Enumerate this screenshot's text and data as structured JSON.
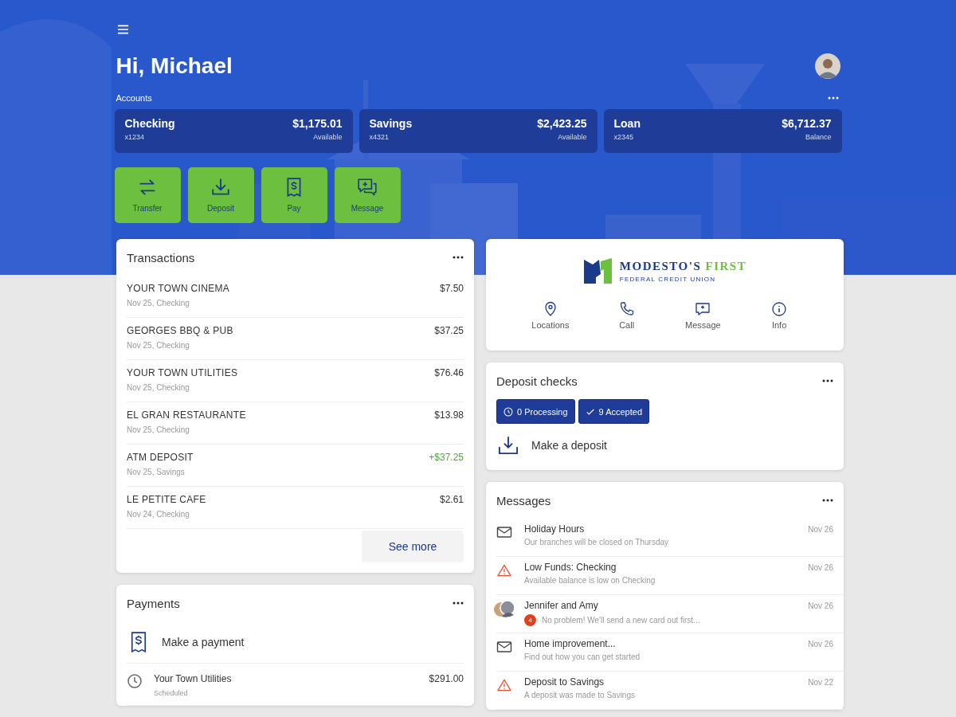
{
  "greeting": "Hi, Michael",
  "accounts_label": "Accounts",
  "accounts": [
    {
      "name": "Checking",
      "number": "x1234",
      "amount": "$1,175.01",
      "caption": "Available"
    },
    {
      "name": "Savings",
      "number": "x4321",
      "amount": "$2,423.25",
      "caption": "Available"
    },
    {
      "name": "Loan",
      "number": "x2345",
      "amount": "$6,712.37",
      "caption": "Balance"
    }
  ],
  "actions": [
    {
      "label": "Transfer",
      "kind": "transfer"
    },
    {
      "label": "Deposit",
      "kind": "deposit"
    },
    {
      "label": "Pay",
      "kind": "pay"
    },
    {
      "label": "Message",
      "kind": "message"
    }
  ],
  "transactions": {
    "title": "Transactions",
    "see_more": "See more",
    "rows": [
      {
        "merchant": "YOUR TOWN CINEMA",
        "detail": "Nov 25, Checking",
        "amount": "$7.50",
        "credit": false
      },
      {
        "merchant": "GEORGES BBQ & PUB",
        "detail": "Nov 25, Checking",
        "amount": "$37.25",
        "credit": false
      },
      {
        "merchant": "YOUR TOWN UTILITIES",
        "detail": "Nov 25, Checking",
        "amount": "$76.46",
        "credit": false
      },
      {
        "merchant": "EL GRAN RESTAURANTE",
        "detail": "Nov 25, Checking",
        "amount": "$13.98",
        "credit": false
      },
      {
        "merchant": "ATM DEPOSIT",
        "detail": "Nov 25, Savings",
        "amount": "+$37.25",
        "credit": true
      },
      {
        "merchant": "LE PETITE CAFE",
        "detail": "Nov 24, Checking",
        "amount": "$2.61",
        "credit": false
      }
    ]
  },
  "payments": {
    "title": "Payments",
    "make_payment": "Make a payment",
    "rows": [
      {
        "payee": "Your Town Utilities",
        "status": "Scheduled",
        "amount": "$291.00"
      }
    ]
  },
  "bank": {
    "name": "MODESTO'S",
    "name_accent": "FIRST",
    "subtitle": "FEDERAL CREDIT UNION",
    "links": [
      {
        "label": "Locations",
        "kind": "pin"
      },
      {
        "label": "Call",
        "kind": "phone"
      },
      {
        "label": "Message",
        "kind": "message"
      },
      {
        "label": "Info",
        "kind": "info"
      }
    ]
  },
  "deposit_checks": {
    "title": "Deposit checks",
    "make_deposit": "Make a deposit",
    "chips": [
      {
        "label": "0 Processing",
        "kind": "clock"
      },
      {
        "label": "9 Accepted",
        "kind": "check"
      }
    ]
  },
  "messages": {
    "title": "Messages",
    "rows": [
      {
        "kind": "mail",
        "title": "Holiday Hours",
        "preview": "Our branches will be closed on Thursday",
        "date": "Nov 26"
      },
      {
        "kind": "alert",
        "title": "Low Funds: Checking",
        "preview": "Available balance is low on Checking",
        "date": "Nov 26"
      },
      {
        "kind": "chat",
        "title": "Jennifer and Amy",
        "preview": "No problem! We'll send a new card out first...",
        "date": "Nov 26",
        "badge": "4"
      },
      {
        "kind": "mail",
        "title": "Home improvement...",
        "preview": "Find out how you can get started",
        "date": "Nov 26"
      },
      {
        "kind": "alert",
        "title": "Deposit to Savings",
        "preview": "A deposit was made to Savings",
        "date": "Nov 22"
      }
    ]
  }
}
